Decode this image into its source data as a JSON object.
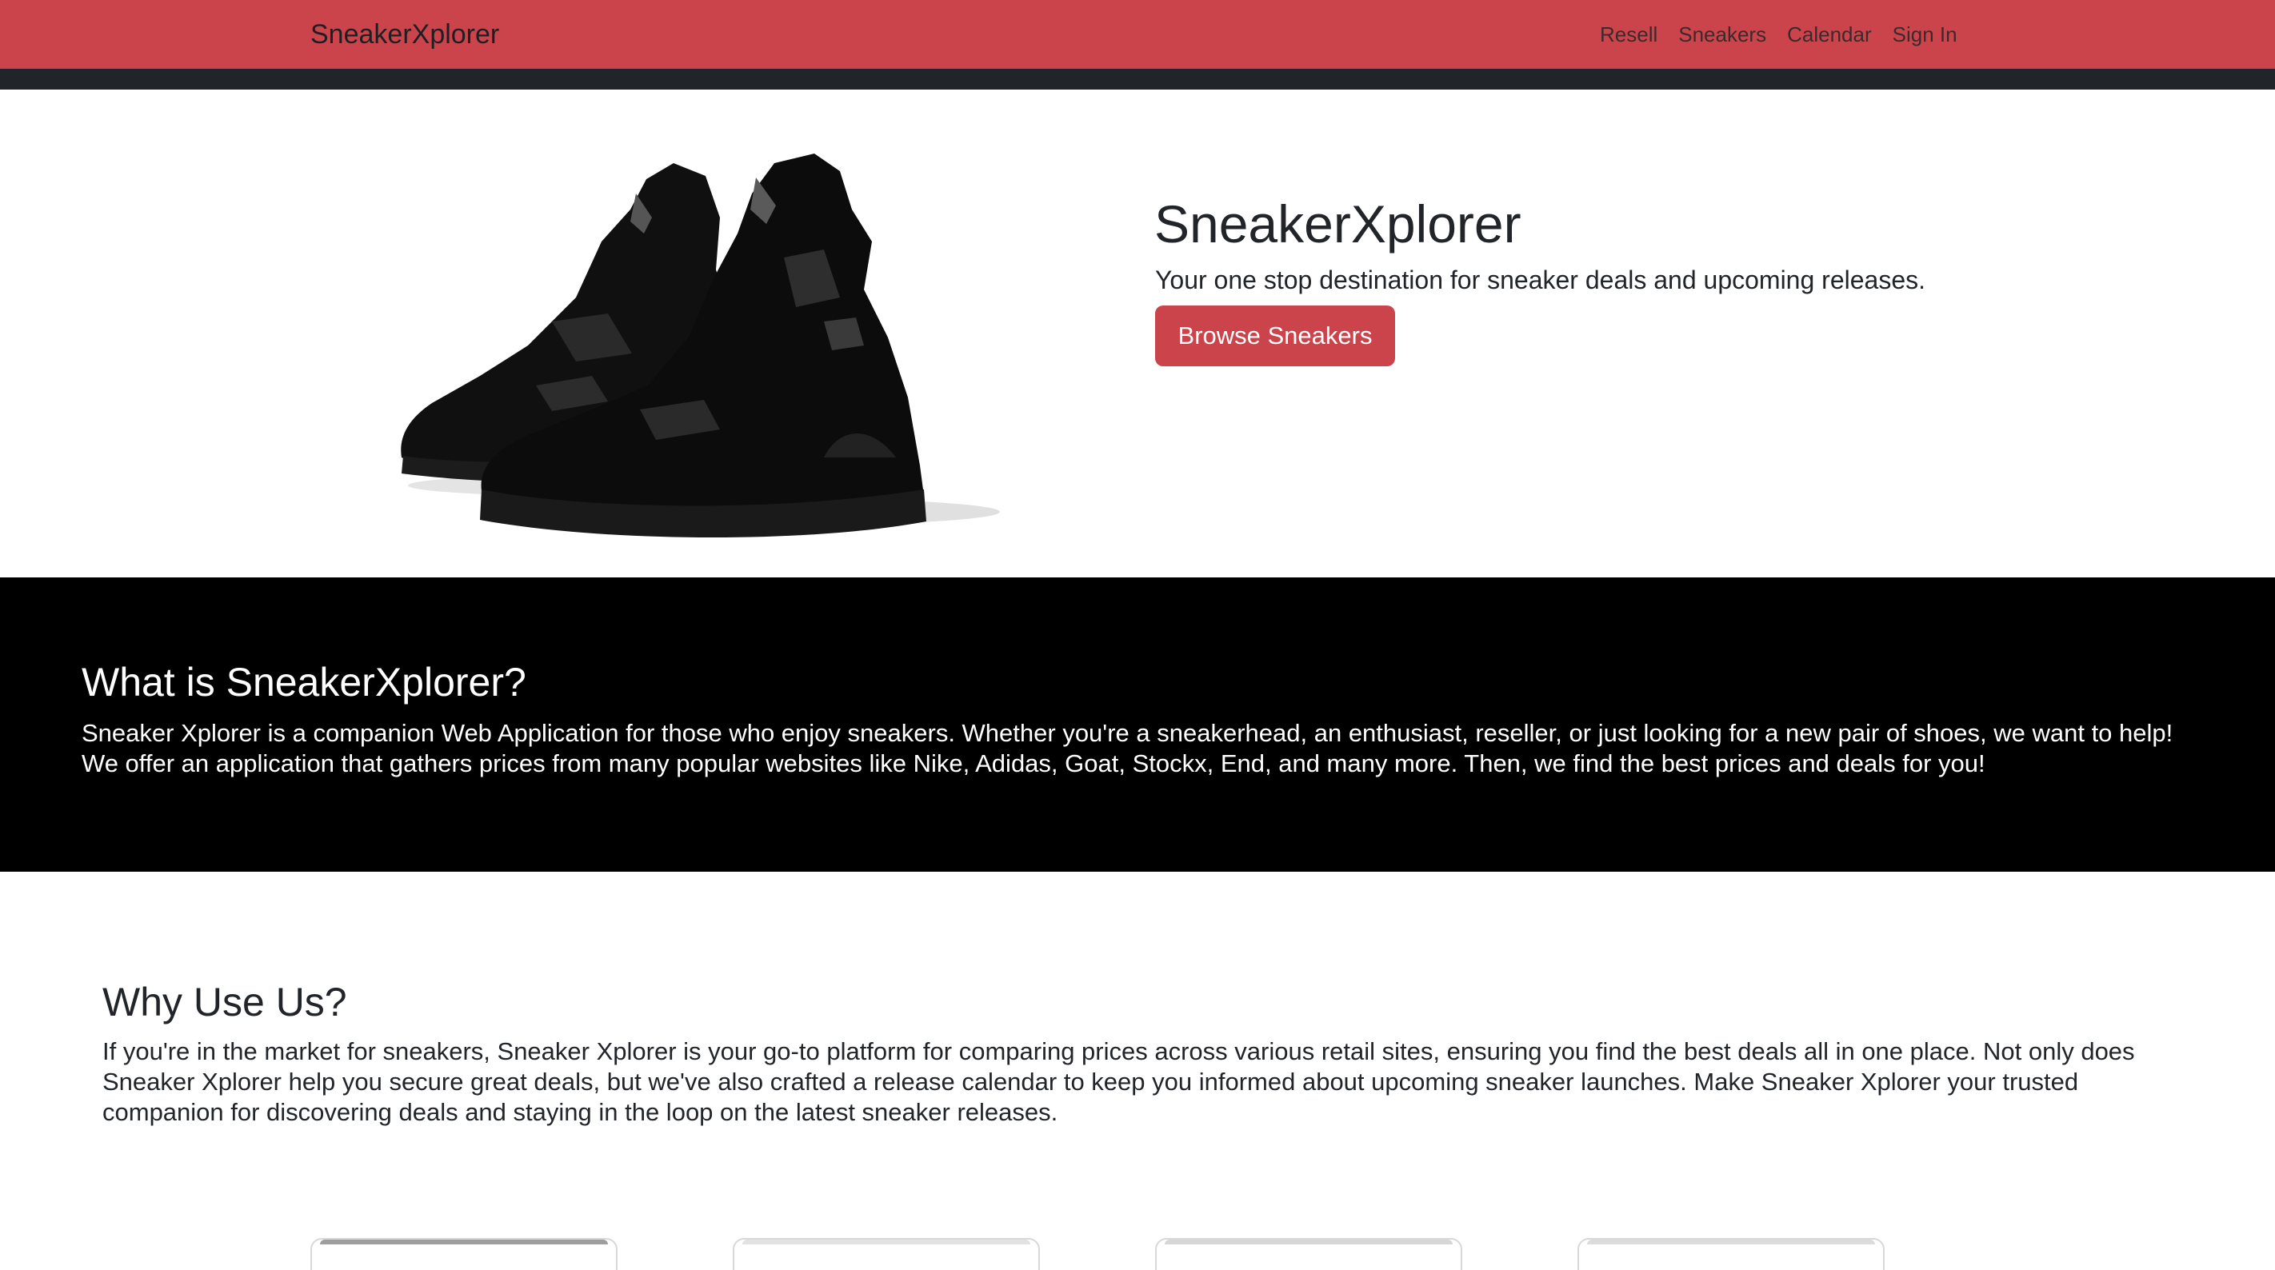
{
  "navbar": {
    "brand": "SneakerXplorer",
    "links": [
      "Resell",
      "Sneakers",
      "Calendar",
      "Sign In"
    ]
  },
  "hero": {
    "image_icon": "sneaker-pair-image",
    "title": "SneakerXplorer",
    "subtitle": "Your one stop destination for sneaker deals and upcoming releases.",
    "button_label": "Browse Sneakers"
  },
  "about": {
    "title": "What is SneakerXplorer?",
    "text": "Sneaker Xplorer is a companion Web Application for those who enjoy sneakers. Whether you're a sneakerhead, an enthusiast, reseller, or just looking for a new pair of shoes, we want to help! We offer an application that gathers prices from many popular websites like Nike, Adidas, Goat, Stockx, End, and many more. Then, we find the best prices and deals for you!"
  },
  "why": {
    "title": "Why Use Us?",
    "text": "If you're in the market for sneakers, Sneaker Xplorer is your go-to platform for comparing prices across various retail sites, ensuring you find the best deals all in one place. Not only does Sneaker Xplorer help you secure great deals, but we've also crafted a release calendar to keep you informed about upcoming sneaker launches. Make Sneaker Xplorer your trusted companion for discovering deals and staying in the loop on the latest sneaker releases."
  },
  "colors": {
    "brand_red": "#cc444b",
    "dark_strip": "#212529",
    "about_bg": "#000000"
  }
}
